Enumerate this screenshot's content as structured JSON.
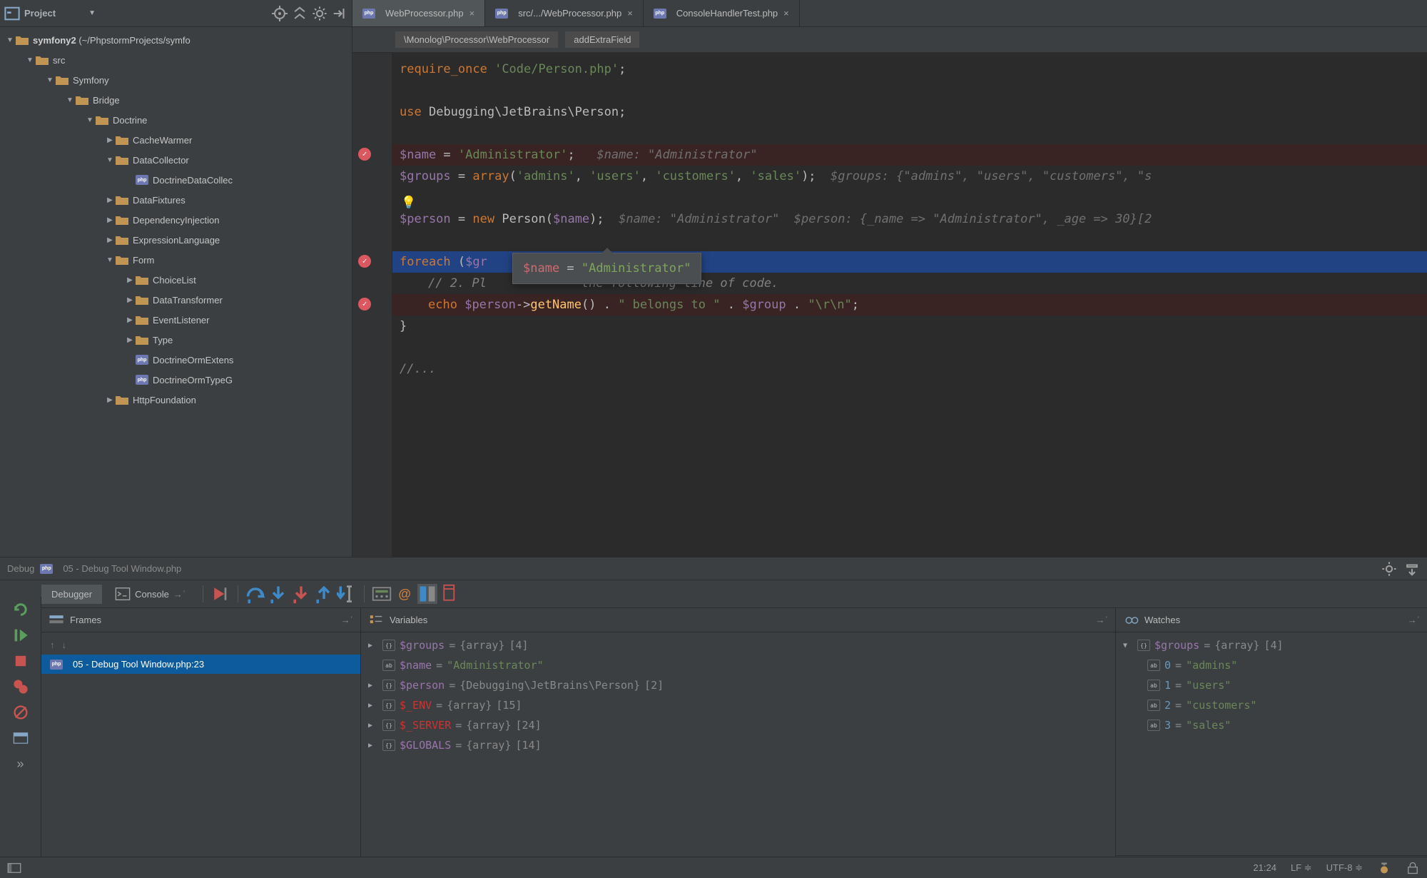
{
  "sidebar": {
    "header_label": "Project",
    "root": {
      "name": "symfony2",
      "path": "(~/PhpstormProjects/symfo"
    },
    "tree": [
      {
        "depth": 1,
        "arrow": "expanded",
        "icon": "folder",
        "label": "src"
      },
      {
        "depth": 2,
        "arrow": "expanded",
        "icon": "folder",
        "label": "Symfony"
      },
      {
        "depth": 3,
        "arrow": "expanded",
        "icon": "folder",
        "label": "Bridge"
      },
      {
        "depth": 4,
        "arrow": "expanded",
        "icon": "folder",
        "label": "Doctrine"
      },
      {
        "depth": 5,
        "arrow": "collapsed",
        "icon": "folder",
        "label": "CacheWarmer"
      },
      {
        "depth": 5,
        "arrow": "expanded",
        "icon": "folder",
        "label": "DataCollector"
      },
      {
        "depth": 6,
        "arrow": "none",
        "icon": "php",
        "label": "DoctrineDataCollec"
      },
      {
        "depth": 5,
        "arrow": "collapsed",
        "icon": "folder",
        "label": "DataFixtures"
      },
      {
        "depth": 5,
        "arrow": "collapsed",
        "icon": "folder",
        "label": "DependencyInjection"
      },
      {
        "depth": 5,
        "arrow": "collapsed",
        "icon": "folder",
        "label": "ExpressionLanguage"
      },
      {
        "depth": 5,
        "arrow": "expanded",
        "icon": "folder",
        "label": "Form"
      },
      {
        "depth": 6,
        "arrow": "collapsed",
        "icon": "folder",
        "label": "ChoiceList"
      },
      {
        "depth": 6,
        "arrow": "collapsed",
        "icon": "folder",
        "label": "DataTransformer"
      },
      {
        "depth": 6,
        "arrow": "collapsed",
        "icon": "folder",
        "label": "EventListener"
      },
      {
        "depth": 6,
        "arrow": "collapsed",
        "icon": "folder",
        "label": "Type"
      },
      {
        "depth": 6,
        "arrow": "none",
        "icon": "php",
        "label": "DoctrineOrmExtens"
      },
      {
        "depth": 6,
        "arrow": "none",
        "icon": "php",
        "label": "DoctrineOrmTypeG"
      },
      {
        "depth": 5,
        "arrow": "collapsed",
        "icon": "folder",
        "label": "HttpFoundation"
      }
    ]
  },
  "tabs": [
    {
      "label": "WebProcessor.php",
      "active": true
    },
    {
      "label": "src/.../WebProcessor.php",
      "active": false
    },
    {
      "label": "ConsoleHandlerTest.php",
      "active": false
    }
  ],
  "breadcrumbs": [
    "\\Monolog\\Processor\\WebProcessor",
    "addExtraField"
  ],
  "code": {
    "l1": {
      "a": "require_once",
      "b": "'Code/Person.php'",
      "c": ";"
    },
    "l2": {
      "a": "use",
      "b": "Debugging\\JetBrains\\Person;"
    },
    "l3": {
      "a": "$name",
      "b": " = ",
      "c": "'Administrator'",
      "d": ";",
      "hint": "$name: \"Administrator\""
    },
    "l4": {
      "a": "$groups",
      "b": " = ",
      "c": "array",
      "d": "(",
      "e": "'admins'",
      "f": ", ",
      "g": "'users'",
      "h": ", ",
      "i": "'customers'",
      "j": ", ",
      "k": "'sales'",
      "l": ");",
      "hint": "$groups: {\"admins\", \"users\", \"customers\", \"s"
    },
    "l5": {
      "a": "$person",
      "b": " = ",
      "c": "new",
      "d": " Person(",
      "e": "$name",
      "f": ");",
      "hint1": "$name: \"Administrator\"",
      "hint2": "$person: {_name => \"Administrator\", _age => 30}[2"
    },
    "l6": {
      "a": "foreach",
      "b": " (",
      "c": "$gr"
    },
    "l7": {
      "a": "// 2. Pl",
      "b": "             ",
      "c": "the following line of code."
    },
    "l8": {
      "a": "echo",
      "b": " ",
      "c": "$person",
      "d": "->",
      "e": "getName",
      "f": "() . ",
      "g": "\" belongs to \"",
      "h": " . ",
      "i": "$group",
      "j": " . ",
      "k": "\"\\r\\n\"",
      "l": ";"
    },
    "l9": "}",
    "l10": "//..."
  },
  "tooltip": {
    "var": "$name",
    "eq": " = ",
    "val": "\"Administrator\""
  },
  "debug": {
    "title_prefix": "Debug",
    "title_file": "05 - Debug Tool Window.php",
    "tab_debugger": "Debugger",
    "tab_console": "Console",
    "frames": {
      "header": "Frames",
      "row": "05 - Debug Tool Window.php:23"
    },
    "variables": {
      "header": "Variables",
      "rows": [
        {
          "arrow": "collapsed",
          "name": "$groups",
          "eq": "=",
          "type": "{array}",
          "extra": "[4]"
        },
        {
          "arrow": "none",
          "name": "$name",
          "eq": "=",
          "val": "\"Administrator\""
        },
        {
          "arrow": "collapsed",
          "name": "$person",
          "eq": "=",
          "type": "{Debugging\\JetBrains\\Person}",
          "extra": "[2]"
        },
        {
          "arrow": "collapsed",
          "name": "$_ENV",
          "eq": "=",
          "type": "{array}",
          "extra": "[15]",
          "red": true
        },
        {
          "arrow": "collapsed",
          "name": "$_SERVER",
          "eq": "=",
          "type": "{array}",
          "extra": "[24]",
          "red": true
        },
        {
          "arrow": "collapsed",
          "name": "$GLOBALS",
          "eq": "=",
          "type": "{array}",
          "extra": "[14]"
        }
      ]
    },
    "watches": {
      "header": "Watches",
      "root": {
        "name": "$groups",
        "eq": "=",
        "type": "{array}",
        "extra": "[4]"
      },
      "items": [
        {
          "k": "0",
          "v": "\"admins\""
        },
        {
          "k": "1",
          "v": "\"users\""
        },
        {
          "k": "2",
          "v": "\"customers\""
        },
        {
          "k": "3",
          "v": "\"sales\""
        }
      ]
    }
  },
  "status": {
    "pos": "21:24",
    "line_sep": "LF",
    "encoding": "UTF-8"
  }
}
